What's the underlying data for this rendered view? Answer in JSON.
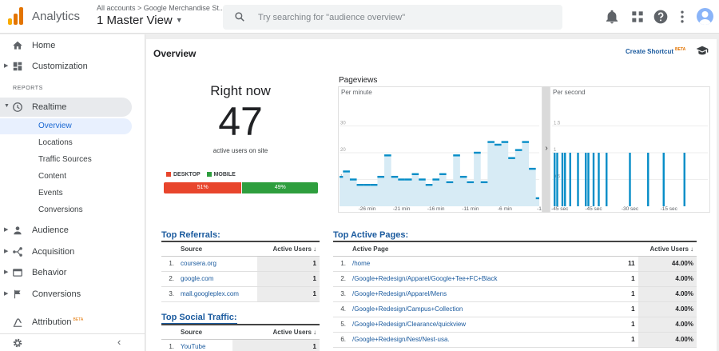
{
  "header": {
    "app_name": "Analytics",
    "breadcrumb": "All accounts > Google Merchandise St...",
    "view_name": "1 Master View",
    "search_placeholder": "Try searching for \"audience overview\"",
    "icons": [
      "bell-icon",
      "apps-grid-icon",
      "help-icon",
      "more-vert-icon",
      "avatar"
    ],
    "logo_colors": [
      "#f9ab00",
      "#e37400",
      "#e37400"
    ]
  },
  "sidebar": {
    "home": "Home",
    "customization": "Customization",
    "section_label": "REPORTS",
    "realtime": "Realtime",
    "realtime_items": [
      "Overview",
      "Locations",
      "Traffic Sources",
      "Content",
      "Events",
      "Conversions"
    ],
    "audience": "Audience",
    "acquisition": "Acquisition",
    "behavior": "Behavior",
    "conversions": "Conversions",
    "attribution": "Attribution",
    "attribution_badge": "BETA"
  },
  "main": {
    "title": "Overview",
    "create_shortcut": "Create Shortcut",
    "shortcut_badge": "BETA",
    "right_now": {
      "title": "Right now",
      "count": "47",
      "subtitle": "active users on site",
      "desktop_label": "DESKTOP",
      "mobile_label": "MOBILE",
      "desktop_pct": "51%",
      "mobile_pct": "49%",
      "desktop_share": 51,
      "desktop_color": "#e8452c",
      "mobile_color": "#2e9e3e"
    },
    "pageviews_title": "Pageviews",
    "top_referrals": {
      "title": "Top Referrals:",
      "col_source": "Source",
      "col_users": "Active Users",
      "rows": [
        {
          "idx": "1.",
          "source": "coursera.org",
          "users": "1"
        },
        {
          "idx": "2.",
          "source": "google.com",
          "users": "1"
        },
        {
          "idx": "3.",
          "source": "mall.googleplex.com",
          "users": "1"
        }
      ]
    },
    "top_social": {
      "title": "Top Social Traffic:",
      "col_source": "Source",
      "col_users": "Active Users",
      "rows": [
        {
          "idx": "1.",
          "source": "YouTube",
          "users": "1"
        }
      ]
    },
    "top_pages": {
      "title": "Top Active Pages:",
      "col_page": "Active Page",
      "col_users": "Active Users",
      "rows": [
        {
          "idx": "1.",
          "page": "/home",
          "users": "11",
          "pct": "44.00%"
        },
        {
          "idx": "2.",
          "page": "/Google+Redesign/Apparel/Google+Tee+FC+Black",
          "users": "1",
          "pct": "4.00%"
        },
        {
          "idx": "3.",
          "page": "/Google+Redesign/Apparel/Mens",
          "users": "1",
          "pct": "4.00%"
        },
        {
          "idx": "4.",
          "page": "/Google+Redesign/Campus+Collection",
          "users": "1",
          "pct": "4.00%"
        },
        {
          "idx": "5.",
          "page": "/Google+Redesign/Clearance/quickview",
          "users": "1",
          "pct": "4.00%"
        },
        {
          "idx": "6.",
          "page": "/Google+Redesign/Nest/Nest-usa.",
          "users": "1",
          "pct": "4.00%"
        }
      ]
    }
  },
  "chart_data": [
    {
      "type": "area",
      "title": "Per minute",
      "ylim": [
        0,
        40
      ],
      "yticks": [
        10,
        20,
        30
      ],
      "xticks": [
        "-26 min",
        "-21 min",
        "-16 min",
        "-11 min",
        "-6 min",
        "-1"
      ],
      "x": [
        -30,
        -29,
        -28,
        -27,
        -26,
        -25,
        -24,
        -23,
        -22,
        -21,
        -20,
        -19,
        -18,
        -17,
        -16,
        -15,
        -14,
        -13,
        -12,
        -11,
        -10,
        -9,
        -8,
        -7,
        -6,
        -5,
        -4,
        -3,
        -2,
        -1
      ],
      "values": [
        11,
        13,
        10,
        8,
        8,
        8,
        11,
        19,
        11,
        10,
        10,
        12,
        10,
        8,
        10,
        12,
        9,
        19,
        11,
        9,
        20,
        9,
        24,
        23,
        24,
        18,
        21,
        24,
        14,
        3
      ],
      "color": "#058dc7",
      "fill": "#d7ebf5"
    },
    {
      "type": "bar",
      "title": "Per second",
      "ylim": [
        0,
        2
      ],
      "yticks": [
        0.5,
        1,
        1.5
      ],
      "xticks": [
        "-45 sec",
        "-45 sec",
        "-30 sec",
        "-15 sec"
      ],
      "x": [
        -59,
        -58,
        -56,
        -55,
        -53,
        -50,
        -47,
        -46,
        -44,
        -42,
        -39,
        -30,
        -23,
        -17,
        -9
      ],
      "values": [
        1,
        1,
        1,
        1,
        1,
        1,
        1,
        1,
        1,
        1,
        1,
        1,
        1,
        1,
        1
      ],
      "color": "#058dc7"
    }
  ]
}
